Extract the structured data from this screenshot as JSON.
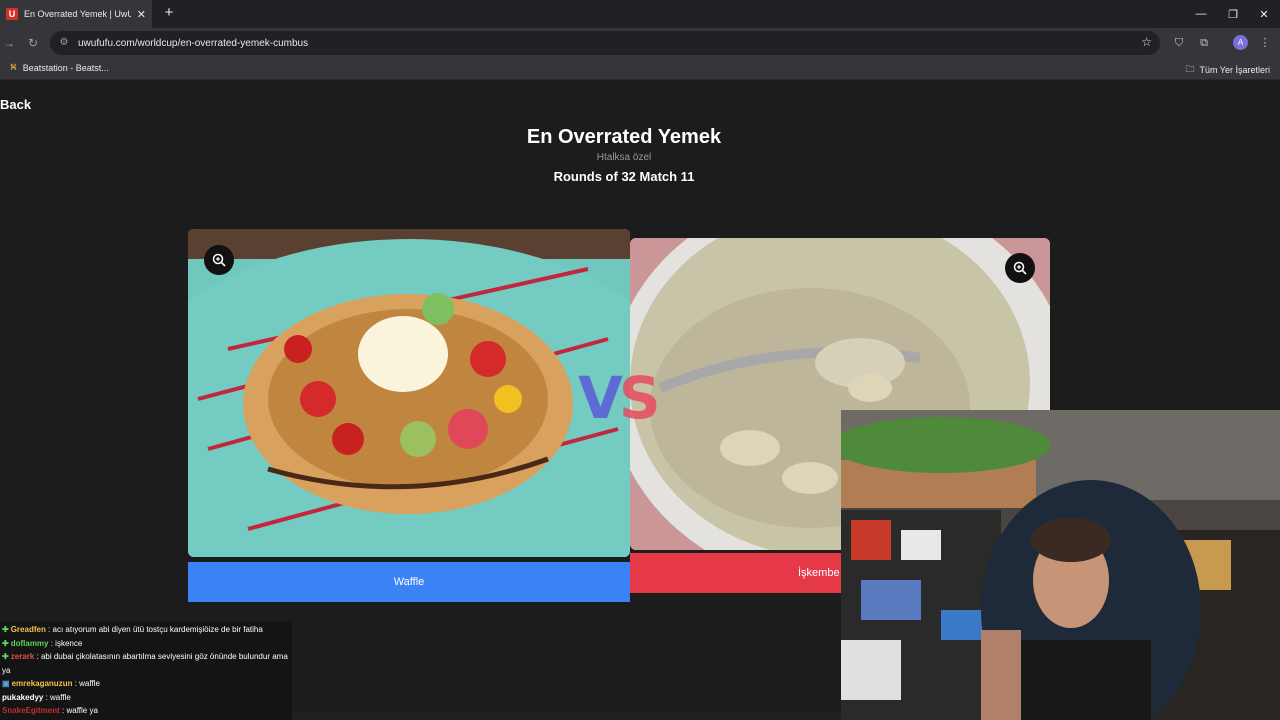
{
  "browser": {
    "tab_title": "En Overrated Yemek | UwUFUFU",
    "tab_favicon": "U",
    "new_tab": "+",
    "url": "uwufufu.com/worldcup/en-overrated-yemek-cumbus",
    "bookmark": "Beatstation - Beatst...",
    "bookmarks_folder": "Tüm Yer İşaretleri",
    "avatar": "A"
  },
  "page": {
    "back_label": "Back",
    "title": "En Overrated Yemek",
    "subtitle": "Htalksa özel",
    "round_label": "Rounds of 32 Match 11"
  },
  "left_choice": {
    "label": "Waffle",
    "color": "#3b82f6"
  },
  "right_choice": {
    "label": "İşkembe",
    "color": "#e63948"
  },
  "vs": {
    "v": "V",
    "s": "S"
  },
  "chat": [
    {
      "user": "Greadfen",
      "color": "#f0c24b",
      "message": " : acı atıyorum abi diyen ütü tostçu kardemişiöize de bir fatiha"
    },
    {
      "user": "doflammy",
      "color": "#5bd45b",
      "message": " : işkence"
    },
    {
      "user": "zerark",
      "color": "#e05050",
      "message": " : abi dubai çikolatasının abartılma seviyesini göz önünde bulundur ama ya"
    },
    {
      "user": "emrekaganuzun",
      "color": "#f0c24b",
      "message": " : waffle"
    },
    {
      "user": "pukakedyy",
      "color": "#ffffff",
      "message": " : waffle"
    },
    {
      "user": "SnakeEgitment",
      "color": "#c03030",
      "message": " : waffle ya"
    }
  ]
}
